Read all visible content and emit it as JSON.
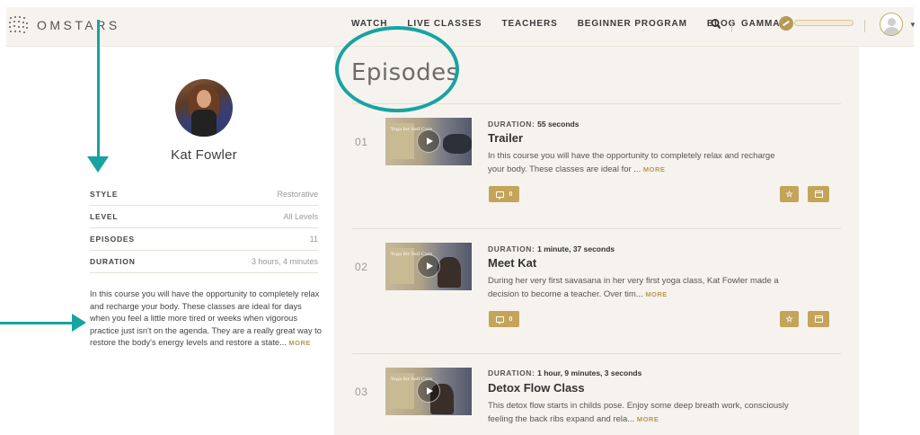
{
  "header": {
    "logo_text": "OMSTARS",
    "nav": [
      "WATCH",
      "LIVE CLASSES",
      "TEACHERS",
      "BEGINNER PROGRAM",
      "BLOG"
    ],
    "account_label": "GAMMA"
  },
  "teacher": {
    "name": "Kat Fowler",
    "meta": [
      {
        "key": "STYLE",
        "value": "Restorative"
      },
      {
        "key": "LEVEL",
        "value": "All Levels"
      },
      {
        "key": "EPISODES",
        "value": "11"
      },
      {
        "key": "DURATION",
        "value": "3 hours, 4 minutes"
      }
    ],
    "description": "In this course you will have the opportunity to completely relax and recharge your body. These classes are ideal for days when you feel a little more tired or weeks when vigorous practice just isn't on the agenda. They are a really great way to restore the body's energy levels and restore a state...",
    "more": "MORE"
  },
  "episodes_title": "Episodes",
  "duration_label": "DURATION:",
  "episodes": [
    {
      "number": "01",
      "duration": "55 seconds",
      "title": "Trailer",
      "description": "In this course you will have the opportunity to completely relax and recharge your body. These classes are ideal for ...",
      "more": "MORE",
      "comments": "0",
      "thumb_text": "Yoga for Self Care"
    },
    {
      "number": "02",
      "duration": "1 minute, 37 seconds",
      "title": "Meet Kat",
      "description": "During her very first savasana in her very first yoga class, Kat Fowler made a decision to become a teacher. Over tim...",
      "more": "MORE",
      "comments": "0",
      "thumb_text": "Yoga for Self Care"
    },
    {
      "number": "03",
      "duration": "1 hour, 9 minutes, 3 seconds",
      "title": "Detox Flow Class",
      "description": "This detox flow starts in childs pose. Enjoy some deep breath work, consciously feeling the back ribs expand and rela...",
      "more": "MORE",
      "thumb_text": "Yoga for Self Care"
    }
  ]
}
